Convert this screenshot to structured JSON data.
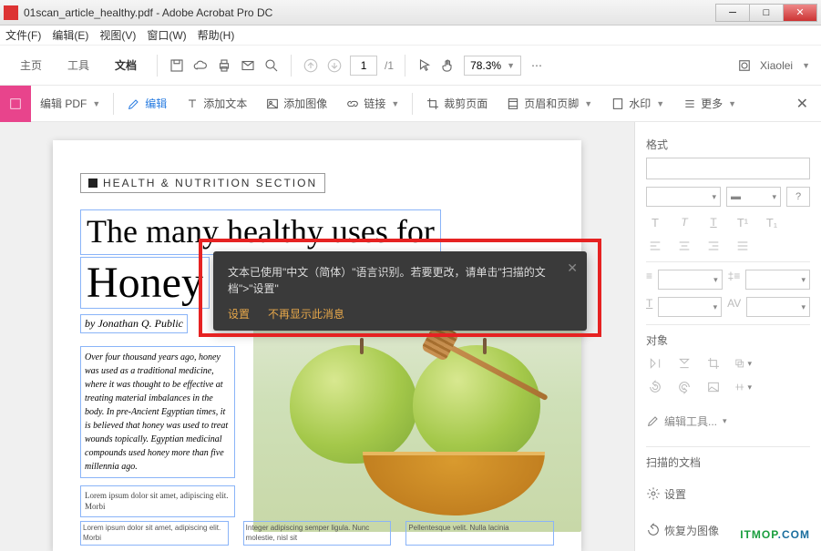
{
  "window": {
    "title": "01scan_article_healthy.pdf - Adobe Acrobat Pro DC"
  },
  "menubar": {
    "file": "文件(F)",
    "edit": "编辑(E)",
    "view": "视图(V)",
    "window": "窗口(W)",
    "help": "帮助(H)"
  },
  "tabs": {
    "home": "主页",
    "tool": "工具",
    "doc": "文档"
  },
  "toolbar": {
    "page_current": "1",
    "page_total": "/1",
    "zoom": "78.3%",
    "user": "Xiaolei"
  },
  "toolbar2": {
    "editpdf": "编辑 PDF",
    "edit": "编辑",
    "addtext": "添加文本",
    "addimage": "添加图像",
    "link": "链接",
    "crop": "裁剪页面",
    "header": "页眉和页脚",
    "watermark": "水印",
    "more": "更多"
  },
  "toast": {
    "line": "文本已使用\"中文（简体）\"语言识别。若要更改，请单击\"扫描的文档\">\"设置\"",
    "settings": "设置",
    "dontshow": "不再显示此消息"
  },
  "rpanel": {
    "format": "格式",
    "object": "对象",
    "edittools": "编辑工具...",
    "scanned": "扫描的文档",
    "settings": "设置",
    "restore": "恢复为图像"
  },
  "doc": {
    "section": "HEALTH & NUTRITION SECTION",
    "headline1": "The many healthy uses for",
    "headline2": "Honey",
    "byline": "by Jonathan Q. Public",
    "body1": "Over four thousand years ago, honey was used as a traditional medicine, where it was thought to be effective at treating material imbalances in the body. In pre-Ancient Egyptian times, it is believed that honey was used to treat wounds topically. Egyptian medicinal compounds used honey more than five millennia ago.",
    "body2": "Lorem ipsum dolor sit amet, adipiscing elit. Morbi",
    "col1": "Lorem ipsum dolor sit amet, adipiscing elit. Morbi",
    "col2": "Integer adipiscing semper ligula. Nunc molestie, nisl sit",
    "col3": "Pellentesque velit. Nulla lacinia"
  },
  "watermark": {
    "text": "ITMOP.COM"
  }
}
